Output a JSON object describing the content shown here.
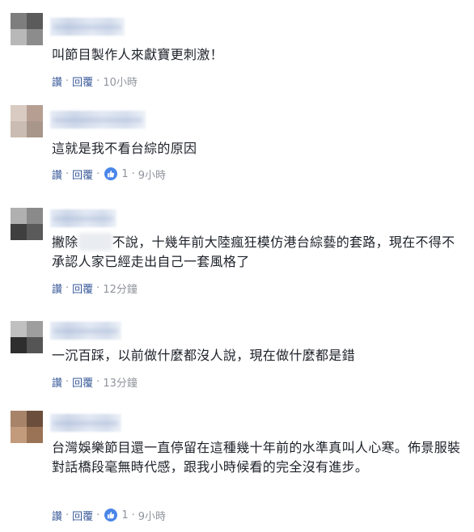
{
  "comments": [
    {
      "text": "叫節目製作人來獻寶更刺激！",
      "actions": {
        "like": "讚",
        "reply": "回覆",
        "time": "10小時"
      }
    },
    {
      "text": "這就是我不看台綜的原因",
      "actions": {
        "like": "讚",
        "reply": "回覆",
        "reaction_count": "1",
        "time": "9小時"
      }
    },
    {
      "text_before": "撇除",
      "text_after": "不說，十幾年前大陸瘋狂模仿港台綜藝的套路，現在不得不承認人家已經走出自己一套風格了",
      "actions": {
        "like": "讚",
        "reply": "回覆",
        "time": "12分鐘"
      }
    },
    {
      "text": "一沉百踩，以前做什麼都沒人說，現在做什麼都是錯",
      "actions": {
        "like": "讚",
        "reply": "回覆",
        "time": "13分鐘"
      }
    },
    {
      "text": "台灣娛樂節目還一直停留在這種幾十年前的水準真叫人心寒。佈景服裝對話橋段毫無時代感，跟我小時候看的完全沒有進步。",
      "actions": {
        "like": "讚",
        "reply": "回覆",
        "reaction_count": "1",
        "time": "9小時"
      }
    }
  ],
  "separator": "·",
  "colors": {
    "link": "#385898",
    "meta": "#90949c",
    "text": "#1d2129",
    "like_badge": "#4a86e8"
  },
  "icons": {
    "reaction": "thumbs-up-icon"
  }
}
